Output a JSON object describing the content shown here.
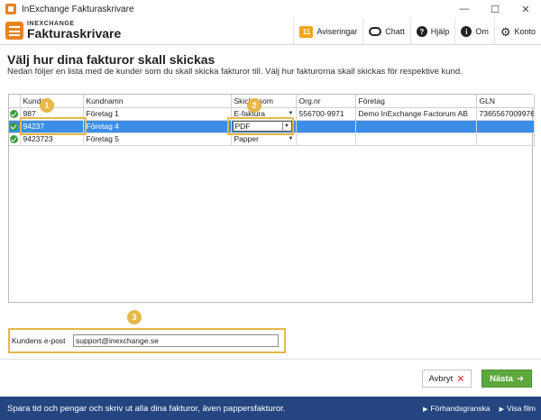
{
  "window": {
    "title": "InExchange Fakturaskrivare",
    "minimize": "—",
    "maximize": "☐",
    "close": "✕"
  },
  "logo": {
    "small": "INEXCHANGE",
    "big": "Fakturaskrivare"
  },
  "nav": {
    "notifications_count": "11",
    "notifications_label": "Aviseringar",
    "chat_label": "Chatt",
    "help_label": "Hjälp",
    "about_label": "Om",
    "account_label": "Konto"
  },
  "page": {
    "title": "Välj hur dina fakturor skall skickas",
    "subtitle": "Nedan följer en lista med de kunder som du skall skicka fakturor till. Välj hur fakturorna skall skickas för respektive kund."
  },
  "table": {
    "columns": {
      "kundnr": "Kundnr",
      "kundnamn": "Kundnamn",
      "skicka_som": "Skicka som",
      "org_nr": "Org.nr",
      "foretag": "Företag",
      "gln": "GLN"
    },
    "rows": [
      {
        "kundnr": "987",
        "kundnamn": "Företag 1",
        "skicka_som": "E-faktura",
        "org_nr": "556700-9971",
        "foretag": "Demo InExchange Factorum AB",
        "gln": "7365567009976"
      },
      {
        "kundnr": "94237",
        "kundnamn": "Företag 4",
        "skicka_som": "PDF",
        "org_nr": "",
        "foretag": "",
        "gln": ""
      },
      {
        "kundnr": "9423723",
        "kundnamn": "Företag 5",
        "skicka_som": "Papper",
        "org_nr": "",
        "foretag": "",
        "gln": ""
      }
    ]
  },
  "markers": [
    "1",
    "2",
    "3"
  ],
  "email": {
    "label": "Kundens e-post",
    "value": "support@inexchange.se"
  },
  "buttons": {
    "cancel": "Avbryt",
    "next": "Nästa"
  },
  "footer": {
    "text": "Spara tid och pengar och skriv ut alla dina fakturor, även pappersfakturor.",
    "preview": "Förhandsgranska",
    "video": "Visa film"
  },
  "colors": {
    "accent_orange": "#e8831f",
    "highlight": "#e6b84a",
    "selected_row": "#3b8ee6",
    "next_button": "#5da83c",
    "footer": "#24457f"
  }
}
